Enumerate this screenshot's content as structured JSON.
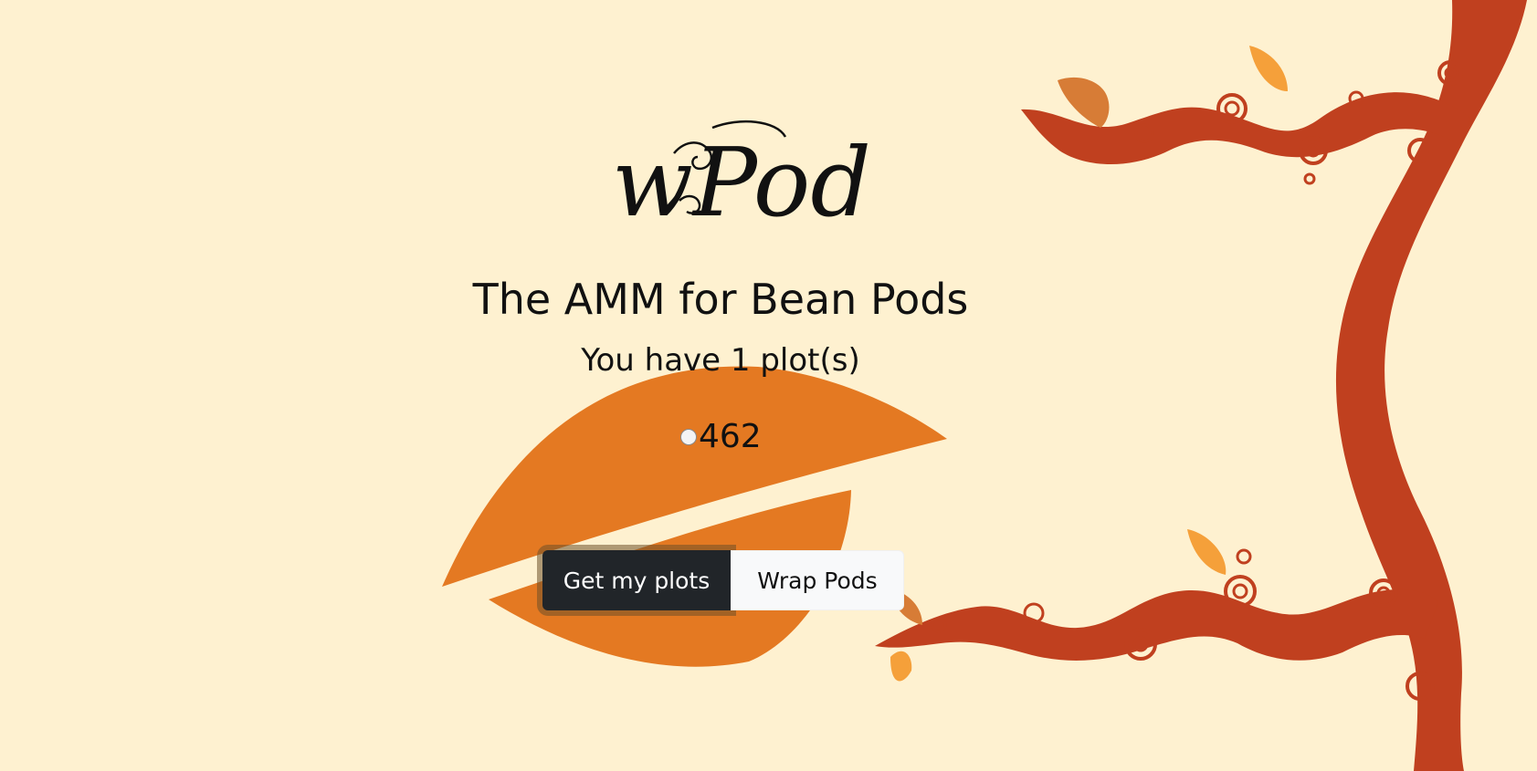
{
  "brand": {
    "logo_text": "wPod"
  },
  "hero": {
    "title": "The AMM for Bean Pods",
    "subtitle": "You have 1 plot(s)"
  },
  "plots": [
    {
      "label": "462",
      "selected": false
    }
  ],
  "actions": {
    "get_plots_label": "Get my plots",
    "wrap_pods_label": "Wrap Pods"
  },
  "colors": {
    "background": "#fef1d0",
    "vine": "#c0401f",
    "leaf_orange": "#e47922",
    "leaf_light": "#f5a03a",
    "button_dark": "#212529",
    "button_light": "#f8f9fa"
  }
}
